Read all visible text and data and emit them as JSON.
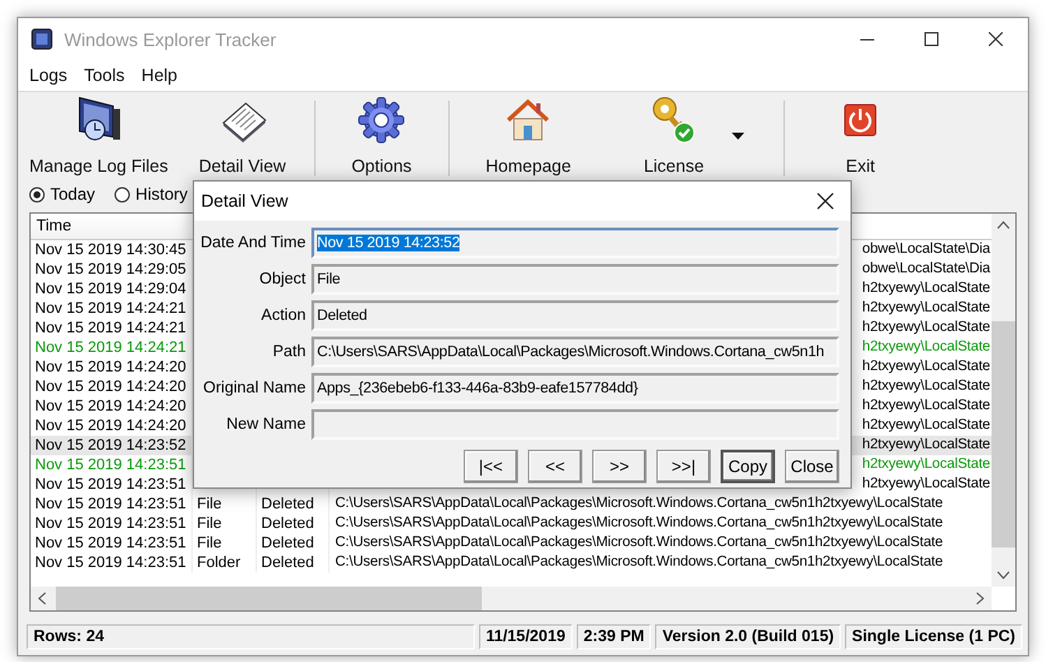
{
  "window": {
    "title": "Windows Explorer Tracker"
  },
  "menu": [
    "Logs",
    "Tools",
    "Help"
  ],
  "toolbar": {
    "groups": [
      {
        "buttons": [
          {
            "label": "Manage Log Files",
            "kind": "logs",
            "dropdown": false
          },
          {
            "label": "Detail View",
            "kind": "detail",
            "dropdown": false
          }
        ]
      },
      {
        "buttons": [
          {
            "label": "Options",
            "kind": "options",
            "dropdown": false
          }
        ]
      },
      {
        "buttons": [
          {
            "label": "Homepage",
            "kind": "home",
            "dropdown": false
          },
          {
            "label": "License",
            "kind": "license",
            "dropdown": true
          }
        ]
      },
      {
        "buttons": [
          {
            "label": "Exit",
            "kind": "exit",
            "dropdown": false
          }
        ]
      }
    ]
  },
  "filter": {
    "options": [
      {
        "label": "Today",
        "selected": true
      },
      {
        "label": "History",
        "selected": false
      }
    ]
  },
  "table": {
    "columns": [
      "Time"
    ],
    "rows": [
      {
        "time": "Nov 15 2019 14:30:45",
        "path": "obwe\\LocalState\\Dia",
        "color": "#000000",
        "selected": false
      },
      {
        "time": "Nov 15 2019 14:29:05",
        "path": "obwe\\LocalState\\Dia",
        "color": "#000000",
        "selected": false
      },
      {
        "time": "Nov 15 2019 14:29:04",
        "path": "h2txyewy\\LocalState",
        "color": "#000000",
        "selected": false
      },
      {
        "time": "Nov 15 2019 14:24:21",
        "path": "h2txyewy\\LocalState",
        "color": "#000000",
        "selected": false
      },
      {
        "time": "Nov 15 2019 14:24:21",
        "path": "h2txyewy\\LocalState",
        "color": "#000000",
        "selected": false
      },
      {
        "time": "Nov 15 2019 14:24:21",
        "path": "h2txyewy\\LocalState",
        "color": "#0a9a0a",
        "selected": false
      },
      {
        "time": "Nov 15 2019 14:24:20",
        "path": "h2txyewy\\LocalState",
        "color": "#000000",
        "selected": false
      },
      {
        "time": "Nov 15 2019 14:24:20",
        "path": "h2txyewy\\LocalState",
        "color": "#000000",
        "selected": false
      },
      {
        "time": "Nov 15 2019 14:24:20",
        "path": "h2txyewy\\LocalState",
        "color": "#000000",
        "selected": false
      },
      {
        "time": "Nov 15 2019 14:24:20",
        "path": "h2txyewy\\LocalState",
        "color": "#000000",
        "selected": false
      },
      {
        "time": "Nov 15 2019 14:23:52",
        "path": "h2txyewy\\LocalState",
        "color": "#000000",
        "selected": true
      },
      {
        "time": "Nov 15 2019 14:23:51",
        "path": "h2txyewy\\LocalState",
        "color": "#0a9a0a",
        "selected": false
      },
      {
        "time": "Nov 15 2019 14:23:51",
        "path": "h2txyewy\\LocalState",
        "color": "#000000",
        "selected": false
      },
      {
        "time": "Nov 15 2019 14:23:51",
        "object": "File",
        "action": "Deleted",
        "path": "C:\\Users\\SARS\\AppData\\Local\\Packages\\Microsoft.Windows.Cortana_cw5n1h2txyewy\\LocalState",
        "color": "#000000",
        "selected": false
      },
      {
        "time": "Nov 15 2019 14:23:51",
        "object": "File",
        "action": "Deleted",
        "path": "C:\\Users\\SARS\\AppData\\Local\\Packages\\Microsoft.Windows.Cortana_cw5n1h2txyewy\\LocalState",
        "color": "#000000",
        "selected": false
      },
      {
        "time": "Nov 15 2019 14:23:51",
        "object": "File",
        "action": "Deleted",
        "path": "C:\\Users\\SARS\\AppData\\Local\\Packages\\Microsoft.Windows.Cortana_cw5n1h2txyewy\\LocalState",
        "color": "#000000",
        "selected": false
      },
      {
        "time": "Nov 15 2019 14:23:51",
        "object": "Folder",
        "action": "Deleted",
        "path": "C:\\Users\\SARS\\AppData\\Local\\Packages\\Microsoft.Windows.Cortana_cw5n1h2txyewy\\LocalState",
        "color": "#000000",
        "selected": false
      }
    ]
  },
  "dialog": {
    "title": "Detail View",
    "fields": [
      {
        "label": "Date And Time",
        "value": "Nov 15 2019 14:23:52",
        "selected": true
      },
      {
        "label": "Object",
        "value": "File",
        "selected": false
      },
      {
        "label": "Action",
        "value": "Deleted",
        "selected": false
      },
      {
        "label": "Path",
        "value": "C:\\Users\\SARS\\AppData\\Local\\Packages\\Microsoft.Windows.Cortana_cw5n1h",
        "selected": false
      },
      {
        "label": "Original Name",
        "value": "Apps_{236ebeb6-f133-446a-83b9-eafe157784dd}",
        "selected": false
      },
      {
        "label": "New Name",
        "selected": false
      }
    ],
    "buttons": [
      {
        "label": "|<<",
        "default": false
      },
      {
        "label": "<<",
        "default": false
      },
      {
        "label": ">>",
        "default": false
      },
      {
        "label": ">>|",
        "default": false
      },
      {
        "label": "Copy",
        "default": true
      },
      {
        "label": "Close",
        "default": false
      }
    ]
  },
  "status_bar": [
    "Rows: 24",
    "11/15/2019",
    "2:39 PM",
    "Version 2.0 (Build 015)",
    "Single License (1 PC)"
  ]
}
